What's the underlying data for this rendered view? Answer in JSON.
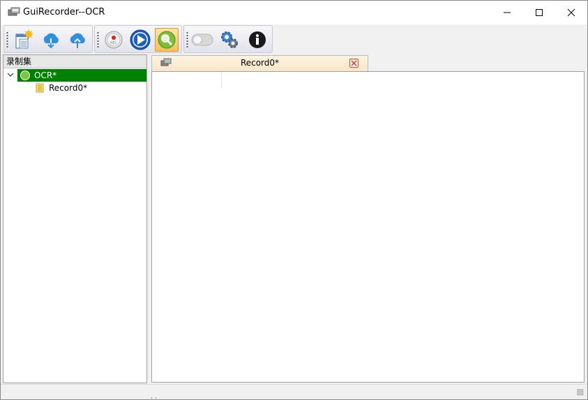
{
  "window": {
    "title": "GuiRecorder--OCR"
  },
  "toolbar": {
    "buttons": [
      {
        "name": "new-record-button",
        "icon": "new-document-icon"
      },
      {
        "name": "download-button",
        "icon": "cloud-download-icon"
      },
      {
        "name": "upload-button",
        "icon": "cloud-upload-icon"
      },
      {
        "name": "record-button",
        "icon": "rec-icon"
      },
      {
        "name": "play-button",
        "icon": "play-icon"
      },
      {
        "name": "ocr-search-button",
        "icon": "magnifier-icon"
      },
      {
        "name": "toggle-button",
        "icon": "toggle-switch-icon"
      },
      {
        "name": "settings-button",
        "icon": "gears-icon"
      },
      {
        "name": "info-button",
        "icon": "info-icon"
      }
    ],
    "active": "ocr-search-button"
  },
  "left_panel": {
    "header": "录制集",
    "tree": {
      "root_label": "OCR*",
      "children": [
        "Record0*"
      ]
    }
  },
  "tabs": [
    {
      "label": "Record0*"
    }
  ],
  "colors": {
    "tree_selected": "#008000",
    "active_tool": "#f6c15a"
  }
}
